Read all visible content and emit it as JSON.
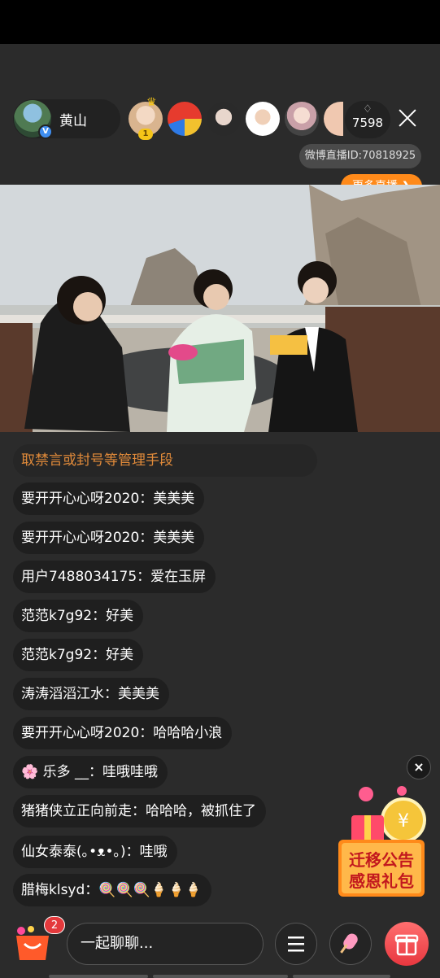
{
  "host": {
    "name": "黄山",
    "verified_mark": "V"
  },
  "viewer_rank": "1",
  "viewer_count": "7598",
  "live_id": "微博直播ID:70818925",
  "more_live": "更多直播 ❯",
  "notice": "取禁言或封号等管理手段",
  "messages": [
    {
      "user": "要开开心心呀2020：",
      "text": "美美美"
    },
    {
      "user": "要开开心心呀2020：",
      "text": "美美美"
    },
    {
      "user": "用户7488034175：",
      "text": "爱在玉屏"
    },
    {
      "user": "范范k7g92：",
      "text": "好美"
    },
    {
      "user": "范范k7g92：",
      "text": "好美"
    },
    {
      "user": "涛涛滔滔江水：",
      "text": "美美美"
    },
    {
      "user": "要开开心心呀2020：",
      "text": "哈哈哈小浪"
    },
    {
      "user": "🌸 乐多 __：",
      "text": "哇哦哇哦"
    },
    {
      "user": "猪猪侠立正向前走：",
      "text": "哈哈哈，被抓住了"
    },
    {
      "user": "仙女泰泰(｡•ᴥ•｡)：",
      "text": "哇哦"
    },
    {
      "user": "腊梅klsyd：",
      "text": "🍭🍭🍭🍦🍦🍦"
    }
  ],
  "promo": {
    "line1": "迁移公告",
    "line2": "感恩礼包"
  },
  "cart_badge": "2",
  "chat_placeholder": "一起聊聊...",
  "icons": {
    "crown": "crown-icon",
    "close": "close-icon",
    "drop": "flame-icon",
    "menu": "menu-icon",
    "brush": "popsicle-icon",
    "gift": "gift-icon",
    "cart": "cart-icon"
  },
  "colors": {
    "accent": "#ff8a1a",
    "notice": "#e08a3a",
    "gift": "#e8373f"
  }
}
